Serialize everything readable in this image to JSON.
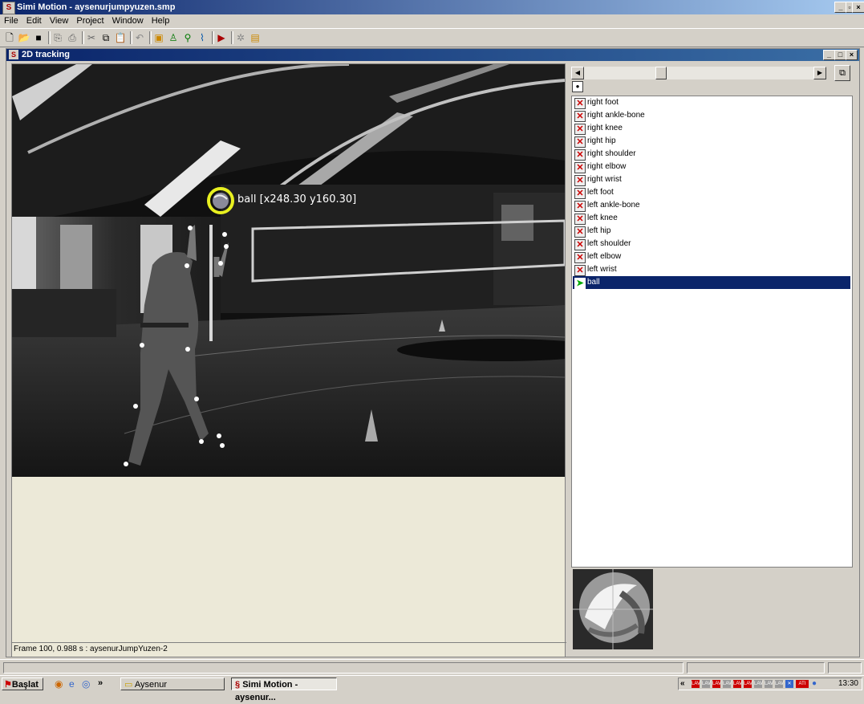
{
  "window": {
    "title": "Simi Motion - aysenurjumpyuzen.smp",
    "minimize": "_",
    "restore": "ř",
    "close": "×"
  },
  "menu": [
    "File",
    "Edit",
    "View",
    "Project",
    "Window",
    "Help"
  ],
  "toolbar": {
    "icons": [
      "new-icon",
      "open-icon",
      "save-icon",
      "copy-page-icon",
      "print-icon",
      "cut-icon",
      "copy-icon",
      "paste-icon",
      "undo-icon",
      "tracking-window-icon",
      "person-icon",
      "walking-icon",
      "graph-icon",
      "video-icon",
      "wizard-icon",
      "folder-export-icon"
    ]
  },
  "tracking_window": {
    "title": "2D tracking",
    "overlay_label": "ball [x248.30 y160.30]",
    "status": "Frame 100, 0.988 s : aysenurJumpYuzen-2"
  },
  "points": [
    {
      "label": "right foot",
      "state": "untracked"
    },
    {
      "label": "right ankle-bone",
      "state": "untracked"
    },
    {
      "label": "right knee",
      "state": "untracked"
    },
    {
      "label": "right hip",
      "state": "untracked"
    },
    {
      "label": "right shoulder",
      "state": "untracked"
    },
    {
      "label": "right elbow",
      "state": "untracked"
    },
    {
      "label": "right wrist",
      "state": "untracked"
    },
    {
      "label": "left foot",
      "state": "untracked"
    },
    {
      "label": "left ankle-bone",
      "state": "untracked"
    },
    {
      "label": "left knee",
      "state": "untracked"
    },
    {
      "label": "left hip",
      "state": "untracked"
    },
    {
      "label": "left shoulder",
      "state": "untracked"
    },
    {
      "label": "left elbow",
      "state": "untracked"
    },
    {
      "label": "left wrist",
      "state": "untracked"
    },
    {
      "label": "ball",
      "state": "selected"
    }
  ],
  "taskbar": {
    "start": "Başlat",
    "quicklaunch_more": "»",
    "folder_task": "Aysenur",
    "app_task": "Simi Motion - aysenur...",
    "tray_more": "«",
    "clock": "13:30"
  },
  "colors": {
    "title_active": "#0a246a",
    "selection": "#0a246a",
    "marker_ring": "#e8f020"
  }
}
